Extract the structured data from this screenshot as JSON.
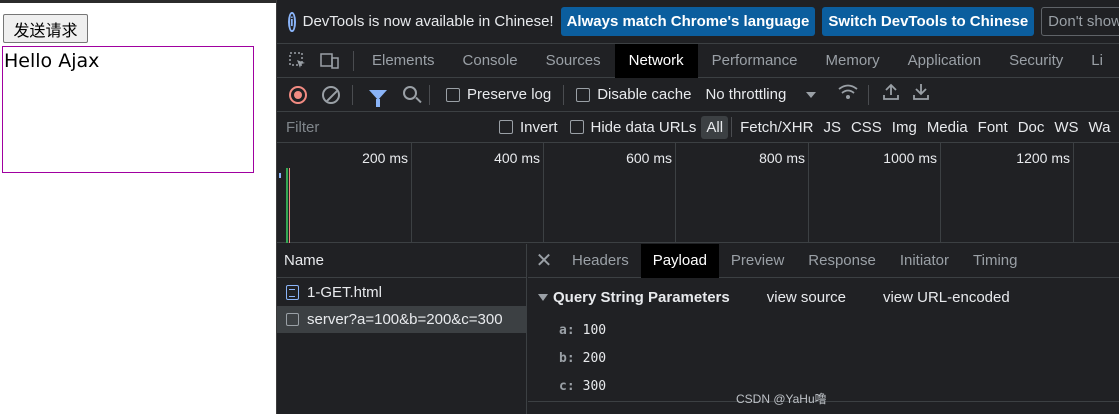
{
  "page": {
    "button_label": "发送请求",
    "result_text": "Hello Ajax"
  },
  "infobar": {
    "message": "DevTools is now available in Chinese!",
    "btn_match": "Always match Chrome's language",
    "btn_switch": "Switch DevTools to Chinese",
    "btn_dismiss": "Don't show ag"
  },
  "tabs": [
    "Elements",
    "Console",
    "Sources",
    "Network",
    "Performance",
    "Memory",
    "Application",
    "Security",
    "Li"
  ],
  "active_tab": "Network",
  "toolbar": {
    "preserve_log": "Preserve log",
    "disable_cache": "Disable cache",
    "throttling": "No throttling"
  },
  "filterbar": {
    "placeholder": "Filter",
    "invert": "Invert",
    "hide_data_urls": "Hide data URLs",
    "types": [
      "All",
      "Fetch/XHR",
      "JS",
      "CSS",
      "Img",
      "Media",
      "Font",
      "Doc",
      "WS",
      "Wa"
    ]
  },
  "timeline": {
    "ticks": [
      "200 ms",
      "400 ms",
      "600 ms",
      "800 ms",
      "1000 ms",
      "1200 ms"
    ]
  },
  "requests": {
    "header": "Name",
    "rows": [
      {
        "name": "1-GET.html",
        "icon": "document-icon"
      },
      {
        "name": "server?a=100&b=200&c=300",
        "icon": "xhr-icon"
      }
    ]
  },
  "detail": {
    "tabs": [
      "Headers",
      "Payload",
      "Preview",
      "Response",
      "Initiator",
      "Timing"
    ],
    "active": "Payload",
    "section_title": "Query String Parameters",
    "view_source": "view source",
    "view_url_encoded": "view URL-encoded",
    "params": [
      {
        "key": "a:",
        "value": "100"
      },
      {
        "key": "b:",
        "value": "200"
      },
      {
        "key": "c:",
        "value": "300"
      }
    ]
  },
  "watermark": "CSDN @YaHu噜",
  "colors": {
    "accent": "#8ab4f8",
    "info_button": "#0b5e9e",
    "record": "#f28b82",
    "result_border": "#a000a0"
  }
}
